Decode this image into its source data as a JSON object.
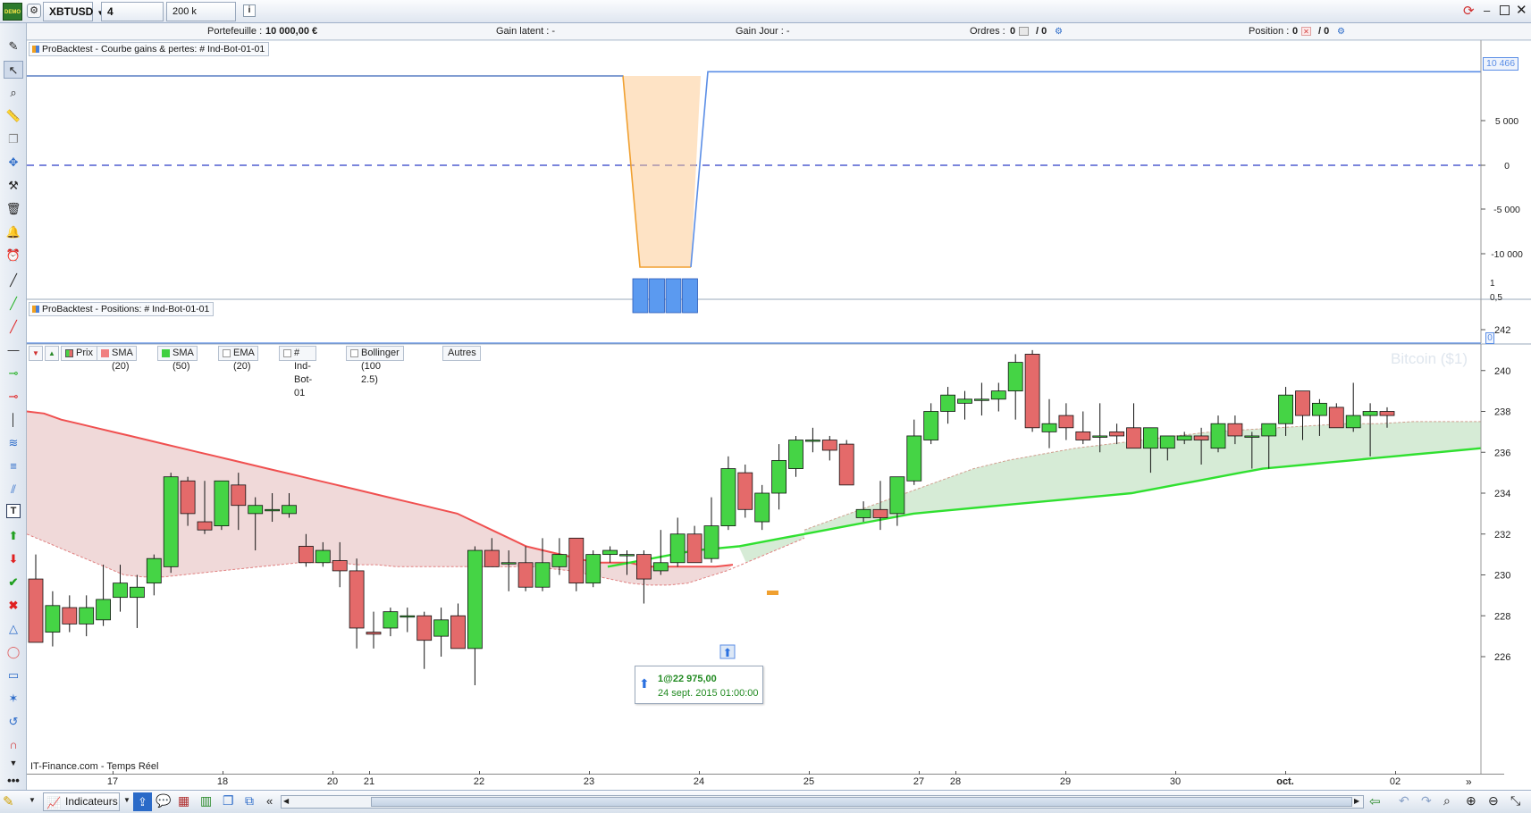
{
  "toolbar": {
    "badge": "DEMO",
    "symbol": "XBTUSD",
    "timeframe": "4 heures",
    "units": "200 k unités"
  },
  "infobar": {
    "portefeuille_label": "Portefeuille :",
    "portefeuille_value": "10 000,00 €",
    "gain_latent": "Gain latent : -",
    "gain_jour": "Gain Jour : -",
    "ordres_label": "Ordres :",
    "ordres_a": "0",
    "ordres_b": "/ 0",
    "position_label": "Position :",
    "position_a": "0",
    "position_b": "/ 0"
  },
  "panels": {
    "equity_label": "ProBacktest - Courbe gains & pertes: # Ind-Bot-01-01",
    "positions_label": "ProBacktest - Positions: # Ind-Bot-01-01",
    "equity_ticks": [
      "5 000",
      "0",
      "-5 000",
      "-10 000"
    ],
    "equity_last": "10 466",
    "position_ticks": [
      "1",
      "0,5",
      "0"
    ]
  },
  "legend": {
    "prix": "Prix",
    "sma20": "SMA (20)",
    "sma50": "SMA (50)",
    "ema20": "EMA (20)",
    "indbot": "# Ind-Bot-01",
    "bollinger": "Bollinger (100 2.5)",
    "autres": "Autres"
  },
  "colors": {
    "up": "#45d445",
    "down": "#e46a6a",
    "sma_red": "#f05050",
    "sma_green": "#30e030",
    "equity_blue": "#5b8ee6",
    "equity_orange": "#f0a030"
  },
  "watermark": "Bitcoin ($1)",
  "source": "IT-Finance.com - Temps Réel",
  "trade_tooltip": {
    "line1": "1@22 975,00",
    "line2": "24 sept. 2015 01:00:00"
  },
  "chart_data": {
    "type": "candlestick",
    "y_ticks": [
      226,
      228,
      230,
      232,
      234,
      236,
      238,
      240,
      242
    ],
    "ylim": [
      224.4,
      242.4
    ],
    "x_labels": [
      "17",
      "18",
      "20",
      "21",
      "22",
      "23",
      "24",
      "25",
      "27",
      "28",
      "29",
      "30",
      "oct.",
      "02"
    ],
    "candles": [
      {
        "o": 229.8,
        "h": 231.0,
        "l": 226.8,
        "c": 226.7
      },
      {
        "o": 227.2,
        "h": 229.2,
        "l": 226.5,
        "c": 228.5
      },
      {
        "o": 228.4,
        "h": 229.0,
        "l": 227.2,
        "c": 227.6
      },
      {
        "o": 227.6,
        "h": 229.0,
        "l": 227.0,
        "c": 228.4
      },
      {
        "o": 227.8,
        "h": 230.5,
        "l": 227.5,
        "c": 228.8
      },
      {
        "o": 228.9,
        "h": 230.5,
        "l": 228.2,
        "c": 229.6
      },
      {
        "o": 228.9,
        "h": 230.0,
        "l": 227.4,
        "c": 229.4
      },
      {
        "o": 229.6,
        "h": 231.0,
        "l": 229.0,
        "c": 230.8
      },
      {
        "o": 230.4,
        "h": 235.0,
        "l": 230.1,
        "c": 234.8
      },
      {
        "o": 234.6,
        "h": 234.8,
        "l": 232.4,
        "c": 233.0
      },
      {
        "o": 232.6,
        "h": 234.6,
        "l": 232.0,
        "c": 232.2
      },
      {
        "o": 232.4,
        "h": 234.4,
        "l": 232.2,
        "c": 234.6
      },
      {
        "o": 234.4,
        "h": 235.0,
        "l": 232.2,
        "c": 233.4
      },
      {
        "o": 233.0,
        "h": 233.8,
        "l": 231.2,
        "c": 233.4
      },
      {
        "o": 233.2,
        "h": 234.0,
        "l": 232.6,
        "c": 233.2
      },
      {
        "o": 233.0,
        "h": 234.0,
        "l": 232.8,
        "c": 233.4
      },
      {
        "o": 231.4,
        "h": 232.0,
        "l": 230.4,
        "c": 230.6
      },
      {
        "o": 230.6,
        "h": 231.6,
        "l": 230.4,
        "c": 231.2
      },
      {
        "o": 230.7,
        "h": 231.6,
        "l": 229.4,
        "c": 230.2
      },
      {
        "o": 230.2,
        "h": 230.8,
        "l": 226.4,
        "c": 227.4
      },
      {
        "o": 227.2,
        "h": 228.2,
        "l": 226.4,
        "c": 227.1
      },
      {
        "o": 227.4,
        "h": 228.4,
        "l": 227.0,
        "c": 228.2
      },
      {
        "o": 228.0,
        "h": 228.4,
        "l": 227.2,
        "c": 228.0
      },
      {
        "o": 228.0,
        "h": 228.2,
        "l": 225.4,
        "c": 226.8
      },
      {
        "o": 227.0,
        "h": 228.4,
        "l": 226.0,
        "c": 227.8
      },
      {
        "o": 228.0,
        "h": 228.6,
        "l": 226.4,
        "c": 226.4
      },
      {
        "o": 226.4,
        "h": 231.4,
        "l": 224.6,
        "c": 231.2
      },
      {
        "o": 231.2,
        "h": 231.8,
        "l": 230.4,
        "c": 230.4
      },
      {
        "o": 230.6,
        "h": 231.2,
        "l": 229.2,
        "c": 230.6
      },
      {
        "o": 230.6,
        "h": 231.4,
        "l": 229.2,
        "c": 229.4
      },
      {
        "o": 229.4,
        "h": 231.8,
        "l": 229.2,
        "c": 230.6
      },
      {
        "o": 230.4,
        "h": 231.8,
        "l": 230.0,
        "c": 231.0
      },
      {
        "o": 231.8,
        "h": 231.8,
        "l": 229.2,
        "c": 229.6
      },
      {
        "o": 229.6,
        "h": 231.2,
        "l": 229.4,
        "c": 231.0
      },
      {
        "o": 231.0,
        "h": 231.4,
        "l": 230.6,
        "c": 231.2
      },
      {
        "o": 231.0,
        "h": 231.2,
        "l": 230.0,
        "c": 231.0
      },
      {
        "o": 231.0,
        "h": 231.2,
        "l": 228.6,
        "c": 229.8
      },
      {
        "o": 230.2,
        "h": 232.2,
        "l": 230.0,
        "c": 230.6
      },
      {
        "o": 230.6,
        "h": 232.8,
        "l": 230.4,
        "c": 232.0
      },
      {
        "o": 232.0,
        "h": 232.4,
        "l": 230.6,
        "c": 230.6
      },
      {
        "o": 230.8,
        "h": 233.8,
        "l": 230.6,
        "c": 232.4
      },
      {
        "o": 232.4,
        "h": 235.8,
        "l": 232.2,
        "c": 235.2
      },
      {
        "o": 235.0,
        "h": 235.4,
        "l": 232.8,
        "c": 233.2
      },
      {
        "o": 232.6,
        "h": 234.4,
        "l": 232.2,
        "c": 234.0
      },
      {
        "o": 234.0,
        "h": 236.4,
        "l": 233.2,
        "c": 235.6
      },
      {
        "o": 235.2,
        "h": 236.8,
        "l": 234.8,
        "c": 236.6
      },
      {
        "o": 236.6,
        "h": 237.2,
        "l": 236.0,
        "c": 236.6
      },
      {
        "o": 236.6,
        "h": 236.8,
        "l": 235.6,
        "c": 236.1
      },
      {
        "o": 236.4,
        "h": 236.6,
        "l": 234.4,
        "c": 234.4
      },
      {
        "o": 232.8,
        "h": 233.6,
        "l": 232.6,
        "c": 233.2
      },
      {
        "o": 233.2,
        "h": 234.6,
        "l": 232.2,
        "c": 232.8
      },
      {
        "o": 233.0,
        "h": 234.8,
        "l": 232.4,
        "c": 234.8
      },
      {
        "o": 234.6,
        "h": 237.6,
        "l": 234.4,
        "c": 236.8
      },
      {
        "o": 236.6,
        "h": 238.4,
        "l": 236.4,
        "c": 238.0
      },
      {
        "o": 238.0,
        "h": 239.2,
        "l": 237.4,
        "c": 238.8
      },
      {
        "o": 238.4,
        "h": 239.0,
        "l": 237.6,
        "c": 238.6
      },
      {
        "o": 238.6,
        "h": 239.4,
        "l": 237.8,
        "c": 238.6
      },
      {
        "o": 238.6,
        "h": 239.4,
        "l": 238.0,
        "c": 239.0
      },
      {
        "o": 239.0,
        "h": 240.8,
        "l": 237.6,
        "c": 240.4
      },
      {
        "o": 240.8,
        "h": 241.0,
        "l": 237.0,
        "c": 237.2
      },
      {
        "o": 237.0,
        "h": 238.6,
        "l": 236.2,
        "c": 237.4
      },
      {
        "o": 237.8,
        "h": 238.4,
        "l": 236.6,
        "c": 237.2
      },
      {
        "o": 237.0,
        "h": 238.0,
        "l": 236.4,
        "c": 236.6
      },
      {
        "o": 236.8,
        "h": 238.4,
        "l": 236.0,
        "c": 236.8
      },
      {
        "o": 237.0,
        "h": 237.4,
        "l": 236.4,
        "c": 236.8
      },
      {
        "o": 237.2,
        "h": 238.4,
        "l": 236.6,
        "c": 236.2
      },
      {
        "o": 236.2,
        "h": 237.2,
        "l": 235.0,
        "c": 237.2
      },
      {
        "o": 236.2,
        "h": 236.6,
        "l": 235.6,
        "c": 236.8
      },
      {
        "o": 236.6,
        "h": 237.0,
        "l": 236.4,
        "c": 236.8
      },
      {
        "o": 236.8,
        "h": 237.2,
        "l": 235.4,
        "c": 236.6
      },
      {
        "o": 236.2,
        "h": 237.8,
        "l": 236.0,
        "c": 237.4
      },
      {
        "o": 237.4,
        "h": 237.8,
        "l": 236.4,
        "c": 236.8
      },
      {
        "o": 236.8,
        "h": 237.0,
        "l": 235.2,
        "c": 236.8
      },
      {
        "o": 236.8,
        "h": 237.4,
        "l": 235.2,
        "c": 237.4
      },
      {
        "o": 237.4,
        "h": 239.2,
        "l": 236.8,
        "c": 238.8
      },
      {
        "o": 239.0,
        "h": 239.0,
        "l": 236.6,
        "c": 237.8
      },
      {
        "o": 237.8,
        "h": 238.6,
        "l": 236.8,
        "c": 238.4
      },
      {
        "o": 238.2,
        "h": 238.4,
        "l": 237.2,
        "c": 237.2
      },
      {
        "o": 237.2,
        "h": 239.4,
        "l": 237.0,
        "c": 237.8
      },
      {
        "o": 237.8,
        "h": 238.4,
        "l": 235.8,
        "c": 238.0
      },
      {
        "o": 238.0,
        "h": 238.2,
        "l": 237.2,
        "c": 237.8
      }
    ],
    "sma20": [
      238.0,
      237.9,
      237.6,
      237.4,
      237.2,
      237.0,
      236.8,
      236.6,
      236.4,
      236.2,
      236.0,
      235.8,
      235.6,
      235.4,
      235.2,
      235.0,
      234.8,
      234.6,
      234.4,
      234.2,
      234.0,
      233.8,
      233.6,
      233.4,
      233.2,
      233.0,
      232.6,
      232.2,
      231.8,
      231.4,
      231.2,
      231.0,
      230.8,
      230.6,
      230.6,
      230.6,
      230.4,
      230.4,
      230.4,
      230.4,
      230.4,
      230.5
    ],
    "sma50": [
      230.4,
      230.6,
      230.8,
      231.0,
      231.2,
      231.3,
      231.4,
      231.6,
      231.8,
      232.0,
      232.2,
      232.4,
      232.6,
      232.8,
      233.0,
      233.1,
      233.2,
      233.3,
      233.4,
      233.5,
      233.6,
      233.7,
      233.8,
      233.9,
      234.0,
      234.2,
      234.4,
      234.6,
      234.8,
      235.0,
      235.2,
      235.3,
      235.4,
      235.5,
      235.6,
      235.7,
      235.8,
      235.9,
      236.0,
      236.1,
      236.2
    ],
    "band_lower": [
      232.0,
      231.6,
      231.2,
      230.8,
      230.4,
      230.0,
      229.9,
      229.9,
      230.0,
      230.1,
      230.2,
      230.3,
      230.4,
      230.5,
      230.6,
      230.6,
      230.6,
      230.5,
      230.5,
      230.4,
      230.4,
      230.4,
      230.4,
      230.4,
      230.4,
      230.4,
      230.4,
      230.3,
      230.2,
      230.0,
      229.8,
      229.6,
      229.5,
      229.5,
      229.6,
      229.9,
      230.2,
      230.6,
      231.0,
      231.4,
      231.8
    ],
    "band_upper": [
      232.2,
      232.8,
      233.4,
      234.0,
      234.6,
      235.2,
      235.6,
      235.9,
      236.2,
      236.4,
      236.6,
      236.8,
      237.0,
      237.1,
      237.2,
      237.3,
      237.4,
      237.4,
      237.5,
      237.5,
      237.5
    ],
    "equity": {
      "before": 10000,
      "min": -11400,
      "after": 10466
    }
  }
}
